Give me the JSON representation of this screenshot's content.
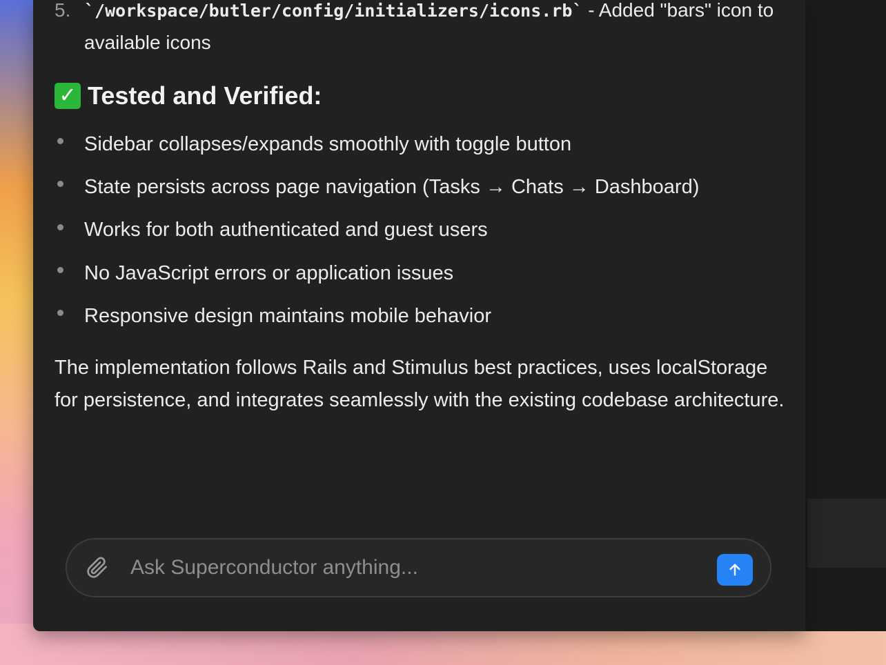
{
  "message": {
    "numbered_item": {
      "marker": "5.",
      "code": "`/workspace/butler/config/initializers/icons.rb`",
      "text_after_code": " - Added \"bars\" icon to available icons"
    },
    "verified_section": {
      "icon": "✓",
      "icon_name": "check-mark-button-icon",
      "heading": "Tested and Verified:",
      "items": [
        "Sidebar collapses/expands smoothly with toggle button",
        "State persists across page navigation (Tasks → Chats → Dashboard)",
        "Works for both authenticated and guest users",
        "No JavaScript errors or application issues",
        "Responsive design maintains mobile behavior"
      ]
    },
    "summary": "The implementation follows Rails and Stimulus best practices, uses localStorage for persistence, and integrates seamlessly with the existing codebase architecture."
  },
  "composer": {
    "placeholder": "Ask Superconductor anything...",
    "attach_icon": "paperclip-icon",
    "send_icon": "arrow-up-icon"
  },
  "colors": {
    "window_bg": "#212121",
    "text": "#ececec",
    "accent": "#2583f5",
    "check": "#2bb83a"
  }
}
